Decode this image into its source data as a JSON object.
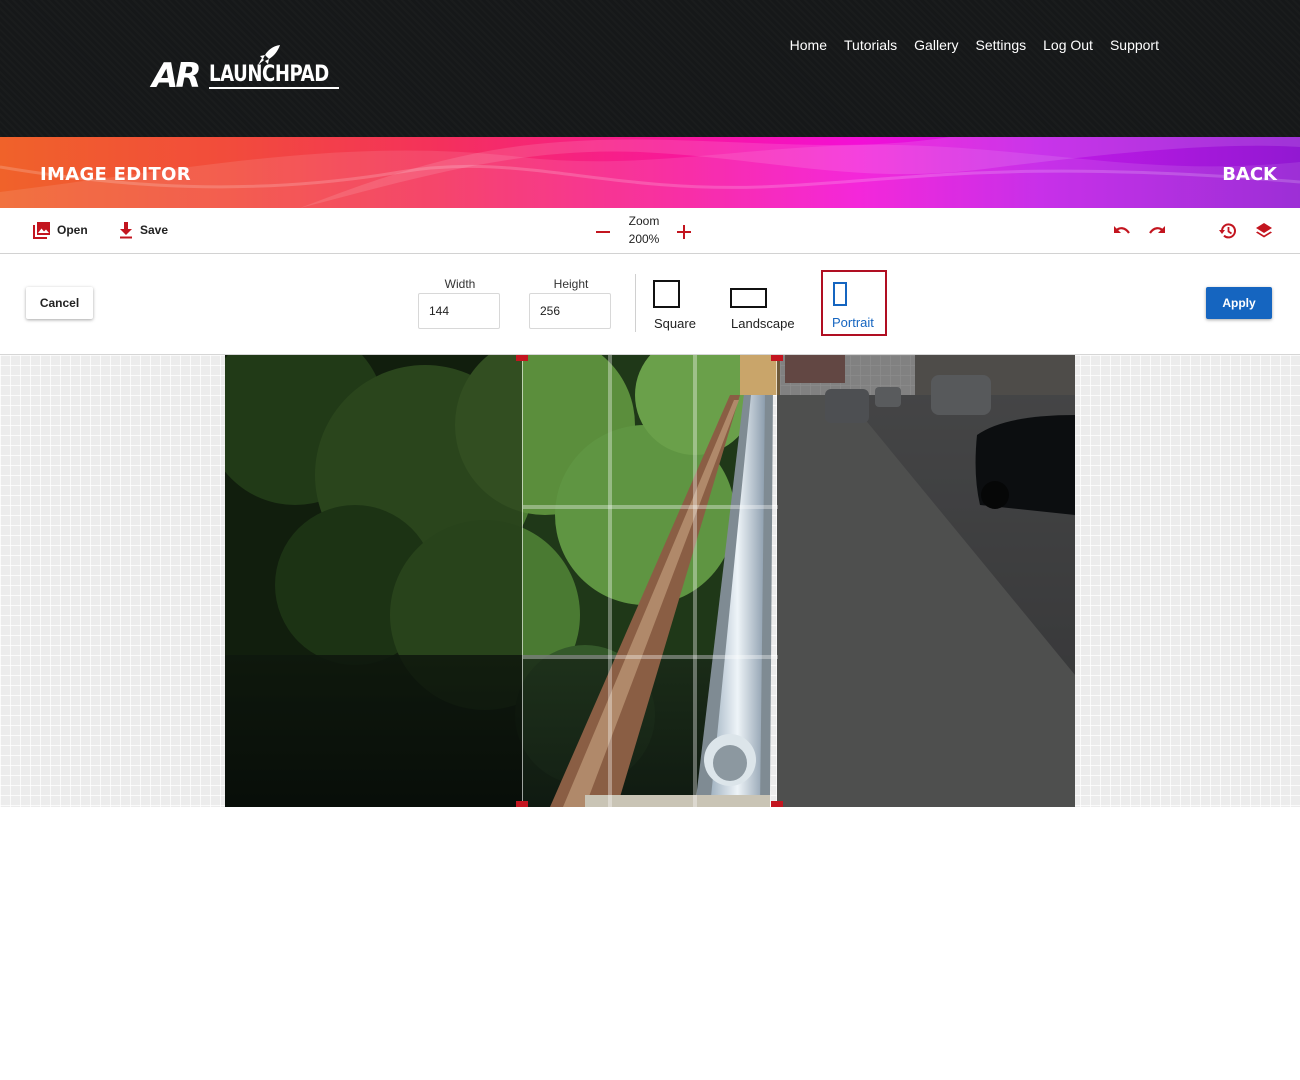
{
  "header": {
    "logo_ar": "AR",
    "logo_text": "LAUNCHPAD",
    "nav": [
      "Home",
      "Tutorials",
      "Gallery",
      "Settings",
      "Log Out",
      "Support"
    ]
  },
  "banner": {
    "title": "IMAGE EDITOR",
    "back_label": "BACK"
  },
  "toolbar": {
    "open_label": "Open",
    "save_label": "Save",
    "zoom_label": "Zoom",
    "zoom_value": "200%",
    "icons": [
      "image-icon",
      "download-icon",
      "minus-icon",
      "plus-icon",
      "undo-icon",
      "redo-icon",
      "history-icon",
      "layers-icon"
    ]
  },
  "crop": {
    "cancel_label": "Cancel",
    "width_label": "Width",
    "width_value": "144",
    "height_label": "Height",
    "height_value": "256",
    "shapes": {
      "square": "Square",
      "landscape": "Landscape",
      "portrait": "Portrait"
    },
    "selected_shape": "portrait",
    "apply_label": "Apply"
  },
  "colors": {
    "header_bg": "#161819",
    "accent_red": "#c3151f",
    "selection_border": "#b00e22",
    "primary_blue": "#1565c0",
    "portrait_blue": "#1565c0"
  }
}
